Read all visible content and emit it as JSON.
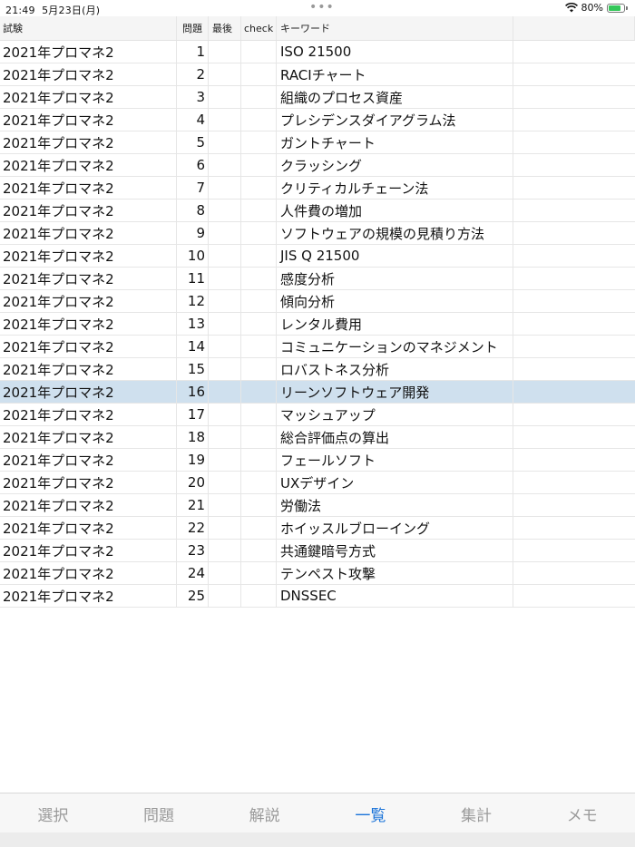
{
  "status": {
    "time": "21:49",
    "date": "5月23日(月)",
    "battery": "80%",
    "battery_level": 0.8,
    "battery_color": "#34c759"
  },
  "table": {
    "headers": {
      "exam": "試験",
      "question": "問題",
      "last": "最後",
      "check": "check",
      "keyword": "キーワード"
    },
    "selected_index": 15,
    "selected_color": "#cfe0ee",
    "rows": [
      {
        "exam": "2021年プロマネ2",
        "num": "1",
        "keyword": "ISO 21500"
      },
      {
        "exam": "2021年プロマネ2",
        "num": "2",
        "keyword": "RACIチャート"
      },
      {
        "exam": "2021年プロマネ2",
        "num": "3",
        "keyword": "組織のプロセス資産"
      },
      {
        "exam": "2021年プロマネ2",
        "num": "4",
        "keyword": "プレシデンスダイアグラム法"
      },
      {
        "exam": "2021年プロマネ2",
        "num": "5",
        "keyword": "ガントチャート"
      },
      {
        "exam": "2021年プロマネ2",
        "num": "6",
        "keyword": "クラッシング"
      },
      {
        "exam": "2021年プロマネ2",
        "num": "7",
        "keyword": "クリティカルチェーン法"
      },
      {
        "exam": "2021年プロマネ2",
        "num": "8",
        "keyword": "人件費の増加"
      },
      {
        "exam": "2021年プロマネ2",
        "num": "9",
        "keyword": "ソフトウェアの規模の見積り方法"
      },
      {
        "exam": "2021年プロマネ2",
        "num": "10",
        "keyword": "JIS Q 21500"
      },
      {
        "exam": "2021年プロマネ2",
        "num": "11",
        "keyword": "感度分析"
      },
      {
        "exam": "2021年プロマネ2",
        "num": "12",
        "keyword": "傾向分析"
      },
      {
        "exam": "2021年プロマネ2",
        "num": "13",
        "keyword": "レンタル費用"
      },
      {
        "exam": "2021年プロマネ2",
        "num": "14",
        "keyword": "コミュニケーションのマネジメント"
      },
      {
        "exam": "2021年プロマネ2",
        "num": "15",
        "keyword": "ロバストネス分析"
      },
      {
        "exam": "2021年プロマネ2",
        "num": "16",
        "keyword": "リーンソフトウェア開発"
      },
      {
        "exam": "2021年プロマネ2",
        "num": "17",
        "keyword": "マッシュアップ"
      },
      {
        "exam": "2021年プロマネ2",
        "num": "18",
        "keyword": "総合評価点の算出"
      },
      {
        "exam": "2021年プロマネ2",
        "num": "19",
        "keyword": "フェールソフト"
      },
      {
        "exam": "2021年プロマネ2",
        "num": "20",
        "keyword": "UXデザイン"
      },
      {
        "exam": "2021年プロマネ2",
        "num": "21",
        "keyword": "労働法"
      },
      {
        "exam": "2021年プロマネ2",
        "num": "22",
        "keyword": "ホイッスルブローイング"
      },
      {
        "exam": "2021年プロマネ2",
        "num": "23",
        "keyword": "共通鍵暗号方式"
      },
      {
        "exam": "2021年プロマネ2",
        "num": "24",
        "keyword": "テンペスト攻撃"
      },
      {
        "exam": "2021年プロマネ2",
        "num": "25",
        "keyword": "DNSSEC"
      }
    ]
  },
  "tabs": [
    {
      "label": "選択",
      "active": false
    },
    {
      "label": "問題",
      "active": false
    },
    {
      "label": "解説",
      "active": false
    },
    {
      "label": "一覧",
      "active": true
    },
    {
      "label": "集計",
      "active": false
    },
    {
      "label": "メモ",
      "active": false
    }
  ],
  "accent_color": "#1a73d9",
  "icons": {
    "wifi": "wifi-icon",
    "battery": "battery-icon",
    "multitask": "multitask-dots-icon"
  }
}
